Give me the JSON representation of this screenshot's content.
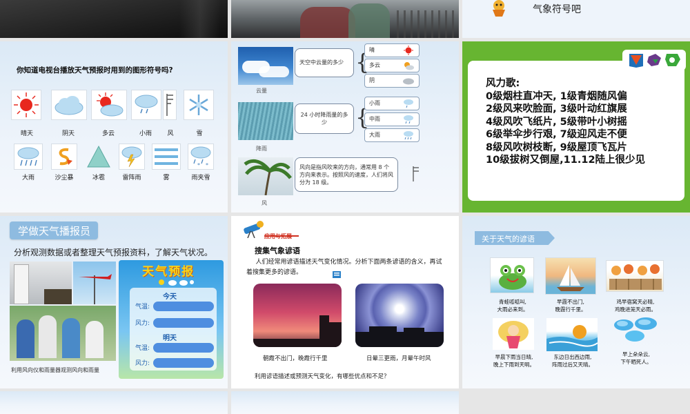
{
  "row0": {
    "top_right_text": "气象符号吧"
  },
  "slide_symbols": {
    "question": "你知道电视台播放天气预报时用到的图形符号吗?",
    "row1": [
      {
        "label": "晴天",
        "icon": "sun-icon"
      },
      {
        "label": "阴天",
        "icon": "cloud-icon"
      },
      {
        "label": "多云",
        "icon": "sun-cloud-icon"
      },
      {
        "label": "小雨",
        "icon": "light-rain-icon"
      },
      {
        "label": "风",
        "icon": "wind-flag-icon"
      },
      {
        "label": "雪",
        "icon": "snowflake-icon"
      }
    ],
    "row2": [
      {
        "label": "大雨",
        "icon": "heavy-rain-icon"
      },
      {
        "label": "沙尘暴",
        "icon": "sandstorm-icon"
      },
      {
        "label": "冰雹",
        "icon": "hail-triangle-icon"
      },
      {
        "label": "雷阵雨",
        "icon": "thunderstorm-icon"
      },
      {
        "label": "雾",
        "icon": "fog-icon"
      },
      {
        "label": "雨夹雪",
        "icon": "sleet-icon"
      }
    ]
  },
  "slide_cloud_rain": {
    "cloud_caption": "云量",
    "cloud_desc": "天空中云量的多少",
    "cloud_options": [
      "晴",
      "多云",
      "阴"
    ],
    "rain_caption": "降雨",
    "rain_desc": "24 小时降雨量的多少",
    "rain_options": [
      "小雨",
      "中雨",
      "大雨"
    ],
    "wind_caption": "风",
    "wind_desc": "风向是指风吹来的方向，通常用 8 个方向来表示。按照风的速度，人们将风分为 18 级。"
  },
  "slide_wind_song": {
    "lines": [
      "风力歌:",
      "0级烟柱直冲天, 1级青烟随风偏",
      "2级风来吹脸面, 3级叶动红旗展",
      "4级风吹飞纸片, 5级带叶小树摇",
      "6级举伞步行艰, 7级迎风走不便",
      "8级风吹树枝断, 9级屋顶飞瓦片",
      "10级拔树又倒屋,11.12陆上很少见"
    ]
  },
  "slide_forecast": {
    "title": "学做天气播报员",
    "subtitle": "分析观测数据或者整理天气预报资料，了解天气状况。",
    "board_title": "天气预报",
    "today": "今天",
    "tomorrow": "明天",
    "temp_label": "气温:",
    "wind_label": "风力:",
    "caption": "利用风向仪和雨量器观测风向和雨量"
  },
  "slide_proverbs_collect": {
    "tag": "应用与拓展",
    "heading": "搜集气象谚语",
    "intro": "人们经常用谚语描述天气变化情况。分析下面两条谚语的含义，再试着搜集更多的谚语。",
    "photo1_caption": "朝霞不出门，晚霞行千里",
    "photo2_caption": "日晕三更雨，月晕午时风",
    "question": "利用谚语描述或预测天气变化，有哪些优点和不足？"
  },
  "slide_proverbs": {
    "title": "关于天气的谚语",
    "items": [
      {
        "line1": "青蛙呱呱叫,",
        "line2": "大雨必来到。"
      },
      {
        "line1": "早霞不出门,",
        "line2": "晚霞行千里。"
      },
      {
        "line1": "鸡早宿窝天必晴,",
        "line2": "鸡晚进笼天必雨。"
      },
      {
        "line1": "早晨下雨当日晴,",
        "line2": "晚上下雨到天明。"
      },
      {
        "line1": "东边日出西边雨,",
        "line2": "阵雨过后又天晴。"
      },
      {
        "line1": "早上朵朵云,",
        "line2": "下午晒死人。"
      }
    ]
  },
  "colors": {
    "green_panel": "#67b531",
    "sun_red": "#e8281e",
    "title_blue": "#8ebbe0"
  }
}
